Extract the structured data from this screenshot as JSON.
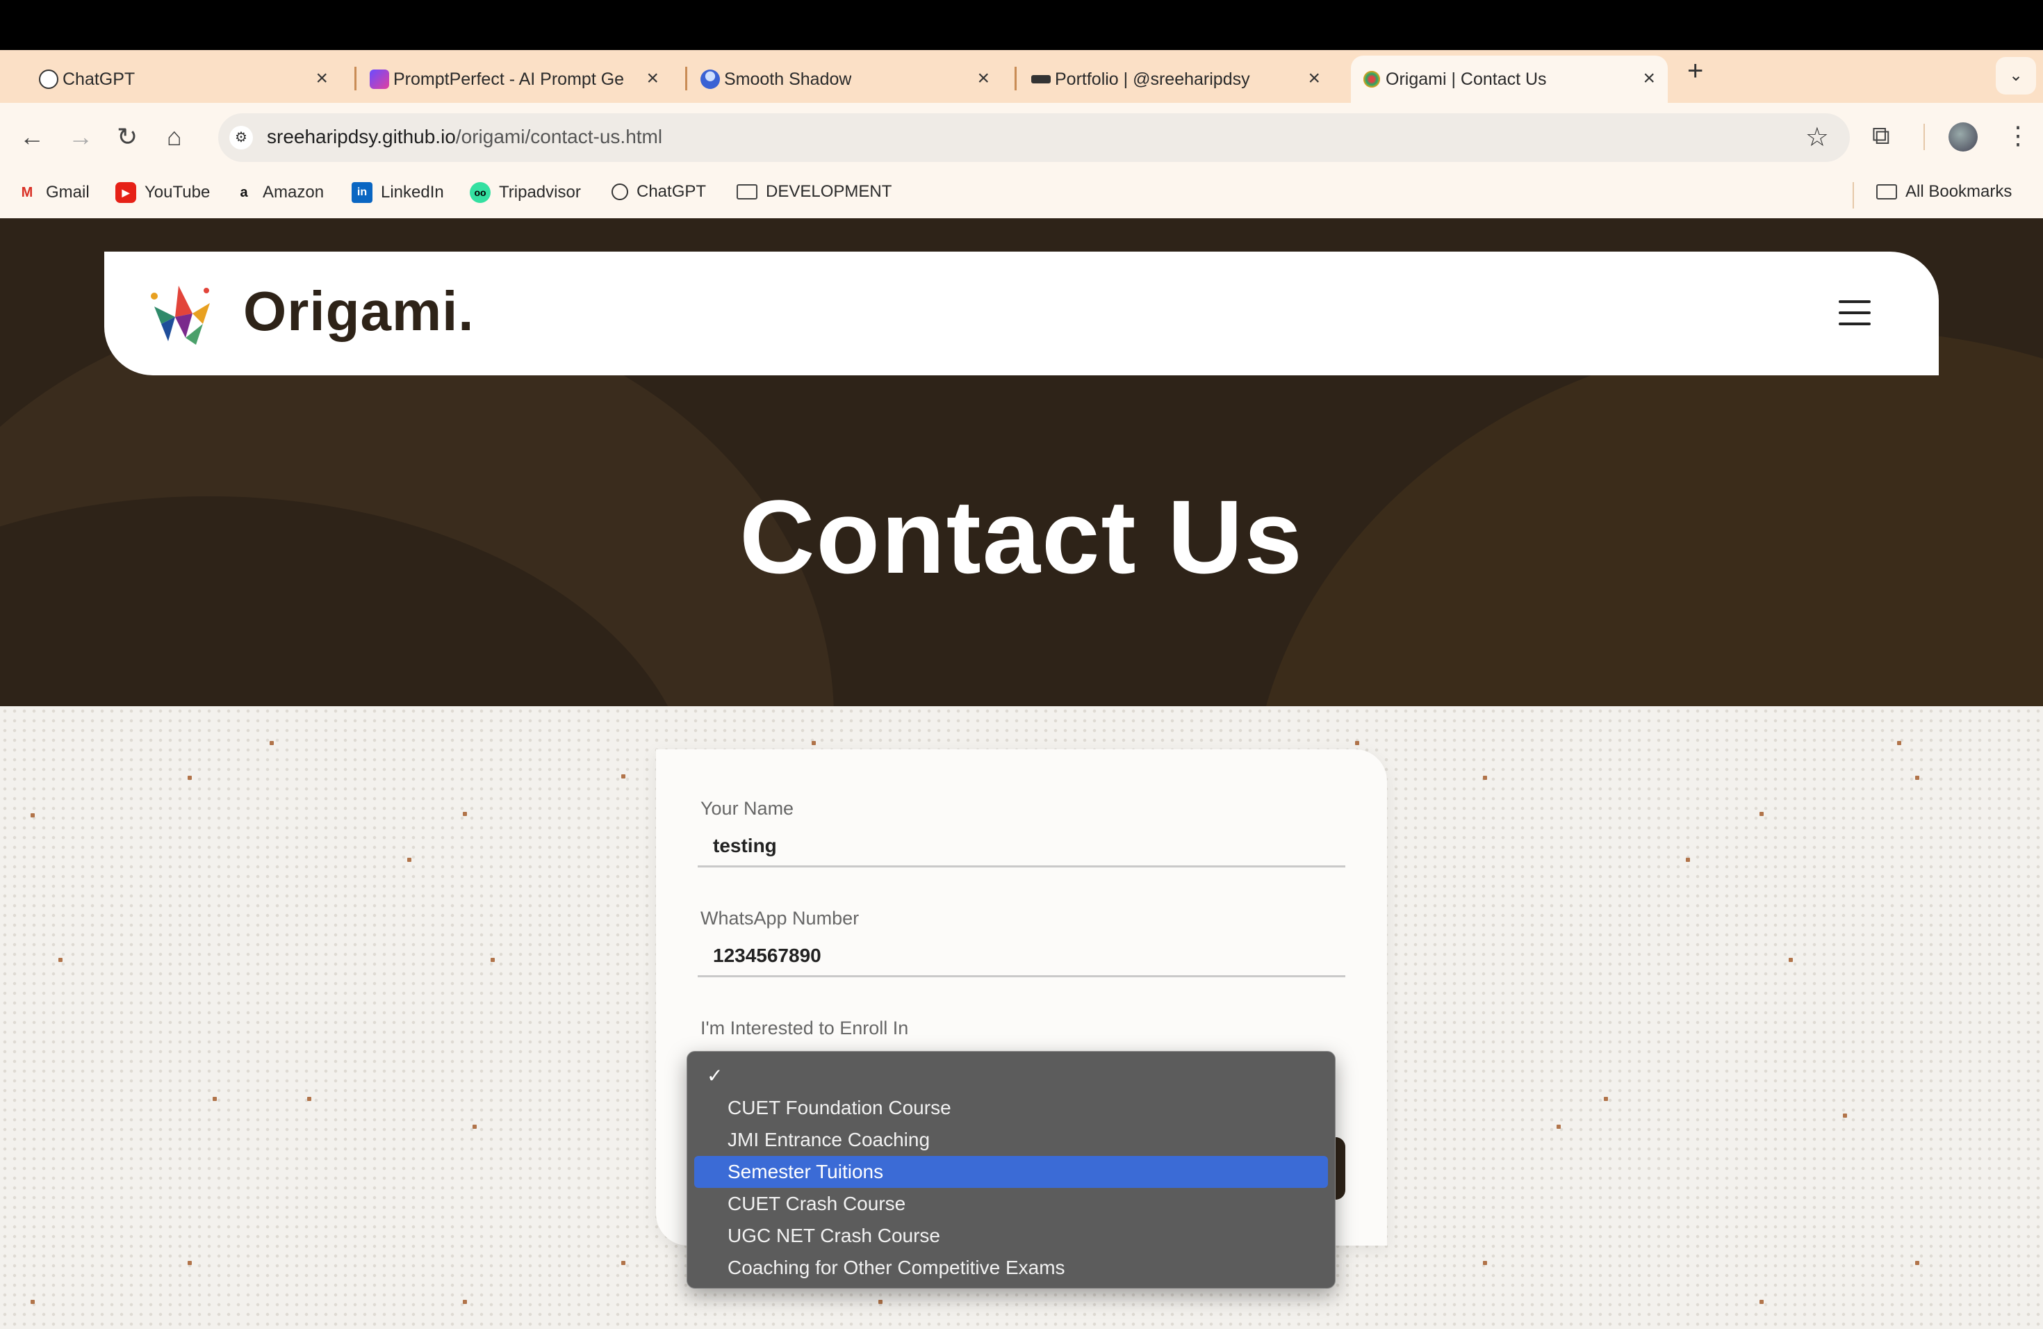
{
  "browser": {
    "tabs": [
      {
        "title": "ChatGPT",
        "favicon": "chatgpt-icon",
        "active": false
      },
      {
        "title": "PromptPerfect - AI Prompt Ge",
        "favicon": "promptperfect-icon",
        "active": false
      },
      {
        "title": "Smooth Shadow",
        "favicon": "smooth-shadow-icon",
        "active": false
      },
      {
        "title": "Portfolio | @sreeharipdsy",
        "favicon": "portfolio-icon",
        "active": false
      },
      {
        "title": "Origami | Contact Us",
        "favicon": "origami-icon",
        "active": true
      }
    ],
    "url_host": "sreeharipdsy.github.io",
    "url_path": "/origami/contact-us.html",
    "bookmarks": [
      {
        "label": "Gmail",
        "icon": "gmail-icon"
      },
      {
        "label": "YouTube",
        "icon": "youtube-icon"
      },
      {
        "label": "Amazon",
        "icon": "amazon-icon"
      },
      {
        "label": "LinkedIn",
        "icon": "linkedin-icon"
      },
      {
        "label": "Tripadvisor",
        "icon": "tripadvisor-icon"
      },
      {
        "label": "ChatGPT",
        "icon": "chatgpt-icon"
      },
      {
        "label": "DEVELOPMENT",
        "icon": "folder-icon"
      }
    ],
    "all_bookmarks": "All Bookmarks"
  },
  "site": {
    "brand": "Origami.",
    "hero_title": "Contact Us"
  },
  "form": {
    "name_label": "Your Name",
    "name_value": "testing",
    "whatsapp_label": "WhatsApp Number",
    "whatsapp_value": "1234567890",
    "enroll_label": "I'm Interested to Enroll In"
  },
  "dropdown": {
    "check_mark": "✓",
    "options": [
      "",
      "CUET Foundation Course",
      "JMI Entrance Coaching",
      "Semester Tuitions",
      "CUET Crash Course",
      "UGC NET Crash Course",
      "Coaching for Other Competitive Exams"
    ],
    "checked_option_index": 0,
    "highlighted_option": "Semester Tuitions"
  },
  "colors": {
    "hero_bg": "#2e2318",
    "tab_strip": "#fbe0c6",
    "highlight": "#3b6bd6",
    "accent_dots": "#b1744a"
  }
}
